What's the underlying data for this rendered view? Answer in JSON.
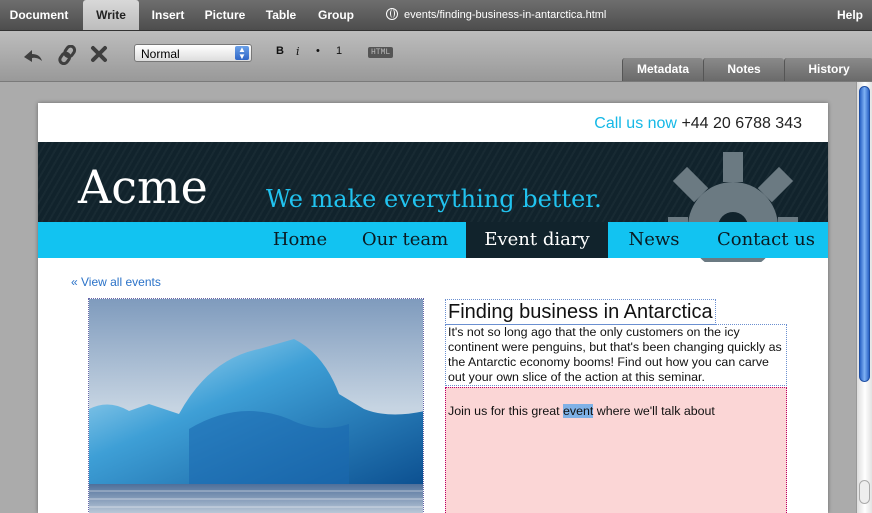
{
  "menubar": {
    "items": [
      "Document",
      "Write",
      "Insert",
      "Picture",
      "Table",
      "Group"
    ],
    "active": "Write",
    "url": "events/finding-business-in-antarctica.html",
    "help": "Help"
  },
  "toolbar": {
    "format_value": "Normal",
    "bold": "B",
    "italic": "i",
    "bullet": "•",
    "number": "1",
    "html": "HTML",
    "tabs": [
      "Metadata",
      "Notes",
      "History"
    ]
  },
  "site": {
    "call_label": "Call us now",
    "phone": "+44 20 6788 343",
    "logo": "Acme",
    "tagline": "We make everything better.",
    "nav": [
      "Home",
      "Our team",
      "Event diary",
      "News",
      "Contact us"
    ],
    "nav_active": "Event diary",
    "view_all": "« View all events"
  },
  "event": {
    "title": "Finding business in Antarctica",
    "description": "It's not so long ago that the only customers on the icy continent were penguins, but that's been changing quickly as the Antarctic economy booms! Find out how you can carve out your own slice of the action at this seminar.",
    "body_before": "Join us for this great ",
    "body_highlight": "event",
    "body_after": " where we'll talk about"
  },
  "colors": {
    "accent_cyan": "#12c3f1",
    "header_dark": "#11232c",
    "selection_pink": "#fbd6d6"
  }
}
